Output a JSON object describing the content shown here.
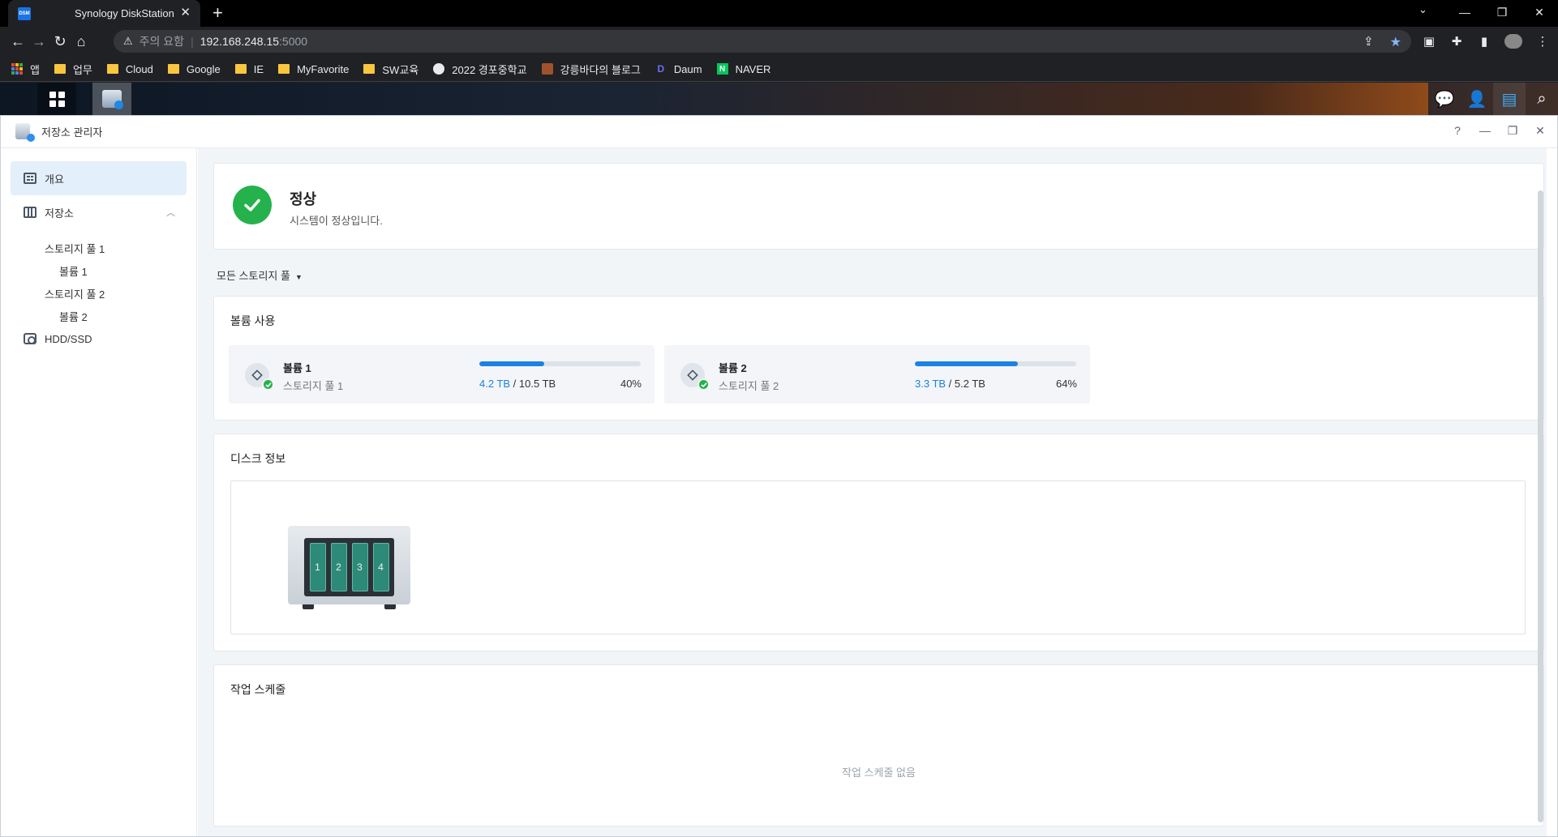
{
  "browser": {
    "tab_title": "Synology DiskStation",
    "tab_favicon_text": "DSM",
    "security_warning": "주의 요함",
    "url_host": "192.168.248.15",
    "url_port": ":5000",
    "bookmarks": [
      {
        "label": "앱",
        "icon": "apps-icon"
      },
      {
        "label": "업무",
        "icon": "folder-icon"
      },
      {
        "label": "Cloud",
        "icon": "folder-icon"
      },
      {
        "label": "Google",
        "icon": "folder-icon"
      },
      {
        "label": "IE",
        "icon": "folder-icon"
      },
      {
        "label": "MyFavorite",
        "icon": "folder-icon"
      },
      {
        "label": "SW교육",
        "icon": "folder-icon"
      },
      {
        "label": "2022 경포중학교",
        "icon": "globe-icon"
      },
      {
        "label": "강릉바다의 블로그",
        "icon": "blog-icon"
      },
      {
        "label": "Daum",
        "icon": "daum-icon"
      },
      {
        "label": "NAVER",
        "icon": "naver-icon"
      }
    ]
  },
  "app": {
    "title": "저장소 관리자",
    "sidebar": {
      "overview": "개요",
      "storage": "저장소",
      "pool1": "스토리지 풀 1",
      "volume1": "볼륨 1",
      "pool2": "스토리지 풀 2",
      "volume2": "볼륨 2",
      "hdd": "HDD/SSD"
    },
    "status": {
      "title": "정상",
      "description": "시스템이 정상입니다."
    },
    "pool_filter": "모든 스토리지 풀",
    "volume_usage": {
      "title": "볼륨 사용",
      "volumes": [
        {
          "name": "볼륨 1",
          "pool": "스토리지 풀 1",
          "used": "4.2 TB",
          "total": "10.5 TB",
          "percent_label": "40%",
          "percent": 40
        },
        {
          "name": "볼륨 2",
          "pool": "스토리지 풀 2",
          "used": "3.3 TB",
          "total": "5.2 TB",
          "percent_label": "64%",
          "percent": 64
        }
      ]
    },
    "disk_info": {
      "title": "디스크 정보",
      "bays": [
        "1",
        "2",
        "3",
        "4"
      ]
    },
    "schedule": {
      "title": "작업 스케줄",
      "empty": "작업 스케줄 없음"
    }
  },
  "colors": {
    "accent": "#1a82e2",
    "success": "#25b24c",
    "bay": "#2e8a78"
  }
}
